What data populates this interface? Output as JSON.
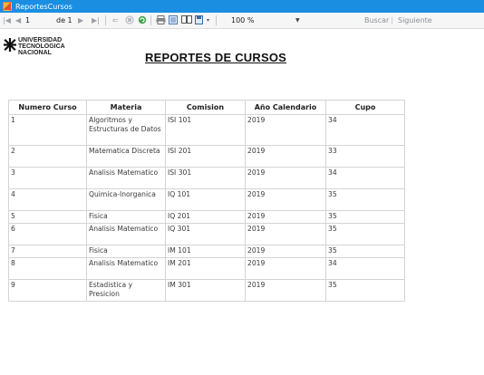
{
  "window": {
    "title": "ReportesCursos"
  },
  "toolbar": {
    "page": "1",
    "of_label": "de 1",
    "zoom": "100 %",
    "find_label": "Buscar",
    "next_label": "Siguiente"
  },
  "report": {
    "logo_lines": [
      "UNIVERSIDAD",
      "TECNOLOGICA",
      "NACIONAL"
    ],
    "title": "REPORTES DE CURSOS",
    "columns": [
      "Numero Curso",
      "Materia",
      "Comision",
      "Año Calendario",
      "Cupo"
    ],
    "rows": [
      {
        "numero": "1",
        "materia": "Algoritmos y Estructuras de Datos",
        "comision": "ISI 101",
        "anio": "2019",
        "cupo": "34"
      },
      {
        "numero": "2",
        "materia": "Matematica Discreta",
        "comision": "ISI 201",
        "anio": "2019",
        "cupo": "33"
      },
      {
        "numero": "3",
        "materia": "Analisis Matematico",
        "comision": "ISI 301",
        "anio": "2019",
        "cupo": "34"
      },
      {
        "numero": "4",
        "materia": "Quimica-Inorganica",
        "comision": "IQ 101",
        "anio": "2019",
        "cupo": "35"
      },
      {
        "numero": "5",
        "materia": "Fisica",
        "comision": "IQ 201",
        "anio": "2019",
        "cupo": "35"
      },
      {
        "numero": "6",
        "materia": "Analisis Matematico",
        "comision": "IQ 301",
        "anio": "2019",
        "cupo": "35"
      },
      {
        "numero": "7",
        "materia": "Fisica",
        "comision": "IM 101",
        "anio": "2019",
        "cupo": "35"
      },
      {
        "numero": "8",
        "materia": "Analisis Matematico",
        "comision": "IM 201",
        "anio": "2019",
        "cupo": "34"
      },
      {
        "numero": "9",
        "materia": "Estadistica y Presicion",
        "comision": "IM 301",
        "anio": "2019",
        "cupo": "35"
      }
    ]
  }
}
